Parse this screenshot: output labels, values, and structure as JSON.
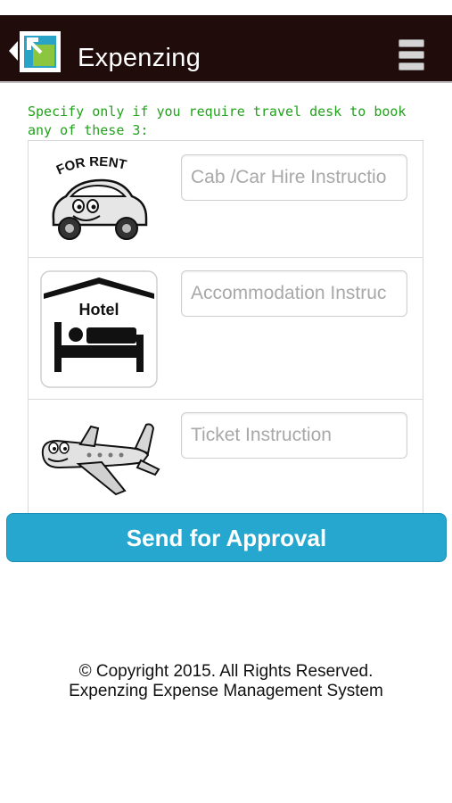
{
  "header": {
    "app_title": "Expenzing",
    "logo_icon": "expenzing-logo-icon",
    "menu_icon": "stacked-menu-icon",
    "bar_color": "#200c0a"
  },
  "form": {
    "instruction": "Specify only if you require travel desk to book any of these 3:",
    "instruction_color": "#22a21c",
    "rows": [
      {
        "icon": "car-for-rent-icon",
        "icon_text": "FOR RENT",
        "placeholder": "Cab /Car Hire Instructio"
      },
      {
        "icon": "hotel-bed-icon",
        "icon_text": "Hotel",
        "placeholder": "Accommodation Instruc"
      },
      {
        "icon": "airplane-icon",
        "placeholder": "Ticket Instruction"
      }
    ]
  },
  "actions": {
    "send_label": "Send for Approval",
    "send_color": "#26a7cf"
  },
  "footer": {
    "copyright": "© Copyright 2015. All Rights Reserved.",
    "product": "Expenzing Expense Management System"
  }
}
